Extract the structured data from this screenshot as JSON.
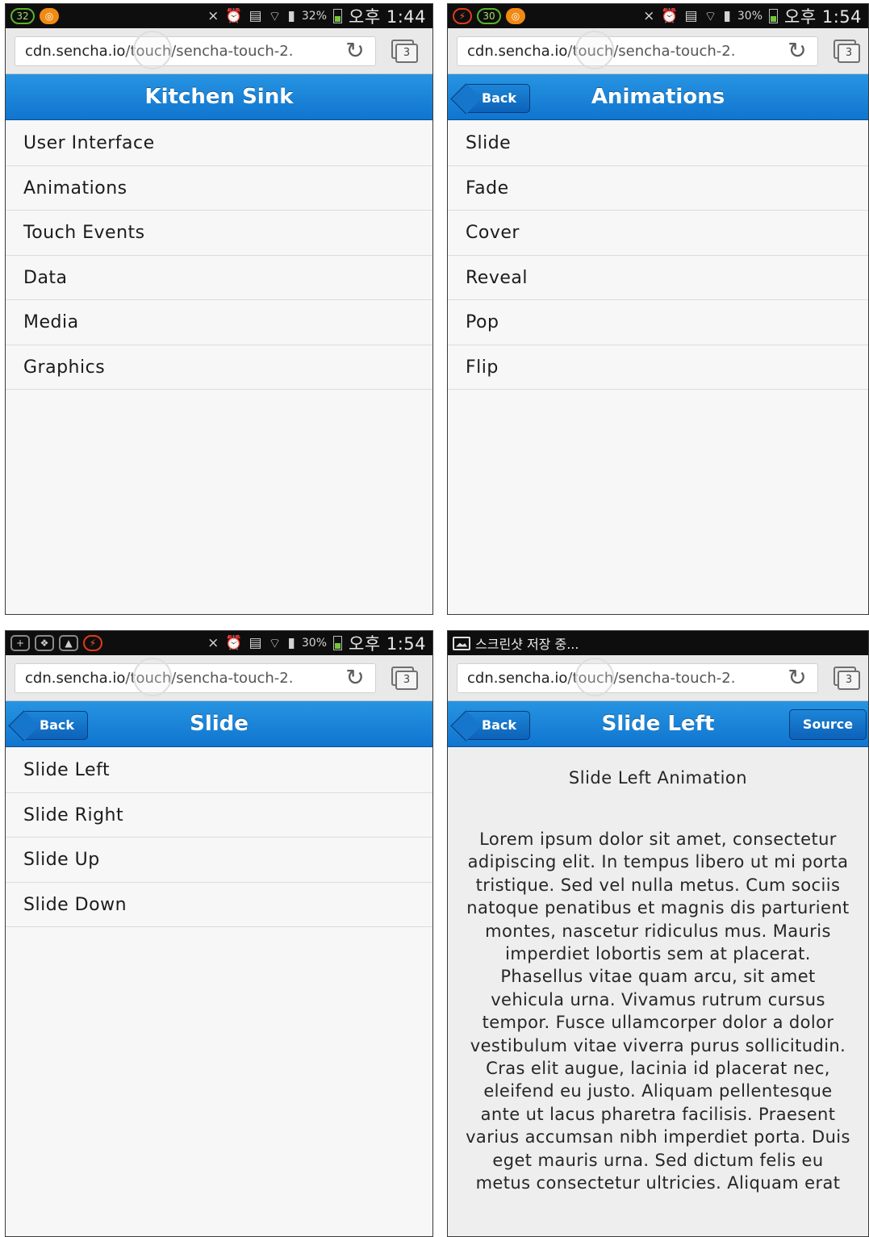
{
  "browser": {
    "url_host": "cdn.sencha.io",
    "url_path": "/touch/sencha-touch-2.",
    "tab_count": "3"
  },
  "icons": {
    "reload": "reload-icon",
    "tabs": "tabs-icon",
    "back": "back-button",
    "status": [
      "wifi-icon",
      "signal-icon",
      "alarm-icon",
      "mute-icon",
      "battery-icon"
    ]
  },
  "colors": {
    "toolbar": "#1a84d8",
    "status_bar": "#0e0e0e"
  },
  "screens": [
    {
      "status": {
        "notification": "32",
        "battery": "32%",
        "time": "오후 1:44"
      },
      "title": "Kitchen Sink",
      "items": [
        "User Interface",
        "Animations",
        "Touch Events",
        "Data",
        "Media",
        "Graphics"
      ]
    },
    {
      "status": {
        "notification": "30",
        "battery": "30%",
        "time": "오후 1:54"
      },
      "title": "Animations",
      "back_label": "Back",
      "items": [
        "Slide",
        "Fade",
        "Cover",
        "Reveal",
        "Pop",
        "Flip"
      ]
    },
    {
      "status": {
        "battery": "30%",
        "time": "오후 1:54"
      },
      "title": "Slide",
      "back_label": "Back",
      "items": [
        "Slide Left",
        "Slide Right",
        "Slide Up",
        "Slide Down"
      ]
    },
    {
      "status": {
        "text": "스크린샷 저장 중..."
      },
      "title": "Slide Left",
      "back_label": "Back",
      "source_label": "Source",
      "heading": "Slide Left Animation",
      "body": "Lorem ipsum dolor sit amet, consectetur adipiscing elit. In tempus libero ut mi porta tristique. Sed vel nulla metus. Cum sociis natoque penatibus et magnis dis parturient montes, nascetur ridiculus mus. Mauris imperdiet lobortis sem at placerat. Phasellus vitae quam arcu, sit amet vehicula urna. Vivamus rutrum cursus tempor. Fusce ullamcorper dolor a dolor vestibulum vitae viverra purus sollicitudin. Cras elit augue, lacinia id placerat nec, eleifend eu justo. Aliquam pellentesque ante ut lacus pharetra facilisis. Praesent varius accumsan nibh imperdiet porta. Duis eget mauris urna. Sed dictum felis eu metus consectetur ultricies. Aliquam erat"
    }
  ]
}
